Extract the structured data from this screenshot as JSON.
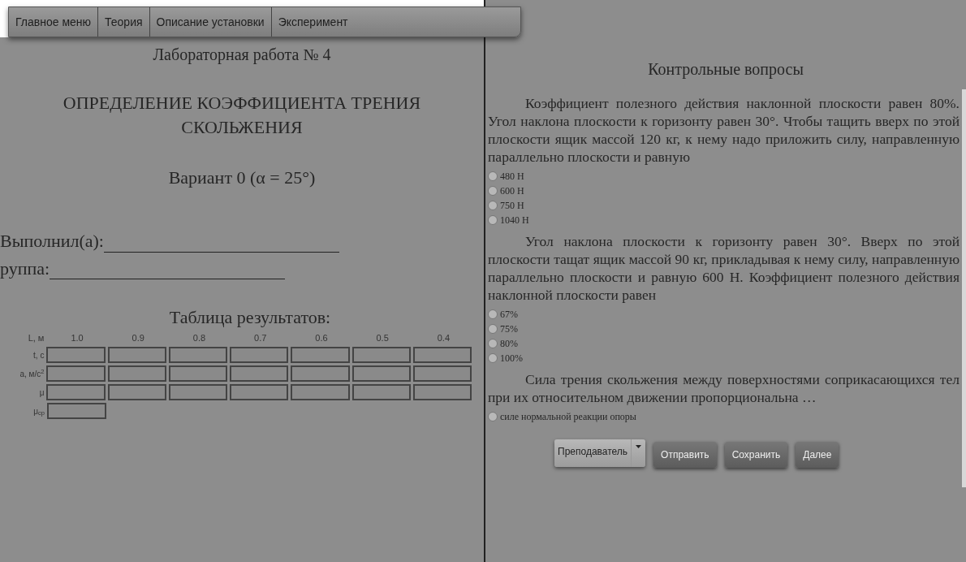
{
  "nav_tabs": [
    {
      "label": "Главное меню"
    },
    {
      "label": "Теория"
    },
    {
      "label": "Описание установки"
    },
    {
      "label": "Эксперимент"
    }
  ],
  "left": {
    "heading": "Лабораторная работа № 4",
    "title": "ОПРЕДЕЛЕНИЕ КОЭФФИЦИЕНТА ТРЕНИЯ СКОЛЬЖЕНИЯ",
    "variant": "Вариант 0 (α = 25°)",
    "fields": [
      {
        "label": "Выполнил(а):"
      },
      {
        "label": "руппа:"
      }
    ],
    "table": {
      "title": "Таблица результатов:",
      "header_label": "L, м",
      "columns": [
        "1.0",
        "0.9",
        "0.8",
        "0.7",
        "0.6",
        "0.5",
        "0.4"
      ],
      "rows": [
        {
          "label": "t, с",
          "kind": "full"
        },
        {
          "label": "a, м/с$^{2}$",
          "kind": "full"
        },
        {
          "label": "μ",
          "kind": "full"
        },
        {
          "label": "μ$_{ср}$",
          "kind": "single"
        }
      ]
    }
  },
  "right": {
    "heading": "Контрольные вопросы",
    "questions": [
      {
        "text": "Коэффициент полезного действия наклонной плоскости равен 80%. Угол наклона плоскости к горизонту равен 30°. Чтобы тащить вверх по этой плоскости ящик массой 120 кг, к нему надо приложить силу, направленную параллельно плоскости и равную",
        "options": [
          {
            "label": "480 Н",
            "selected": false
          },
          {
            "label": "600 Н",
            "selected": false
          },
          {
            "label": "750 Н",
            "selected": false
          },
          {
            "label": "1040 Н",
            "selected": false
          }
        ]
      },
      {
        "text": "Угол наклона плоскости к горизонту равен 30°. Вверх по этой плоскости тащат ящик массой 90 кг, прикладывая к нему силу, направленную параллельно плоскости и равную 600 Н. Коэффициент полезного действия наклонной плоскости равен",
        "options": [
          {
            "label": "67%",
            "selected": false
          },
          {
            "label": "75%",
            "selected": false
          },
          {
            "label": "80%",
            "selected": false
          },
          {
            "label": "100%",
            "selected": false
          }
        ]
      },
      {
        "text": "Сила трения скольжения между поверхностями соприкасающихся тел при их относительном движении пропорциональна …",
        "options": [
          {
            "label": "силе нормальной реакции опоры",
            "selected": false
          }
        ]
      }
    ],
    "role_select": {
      "value": "Преподаватель"
    },
    "buttons": [
      "Отправить",
      "Сохранить",
      "Далее"
    ]
  }
}
